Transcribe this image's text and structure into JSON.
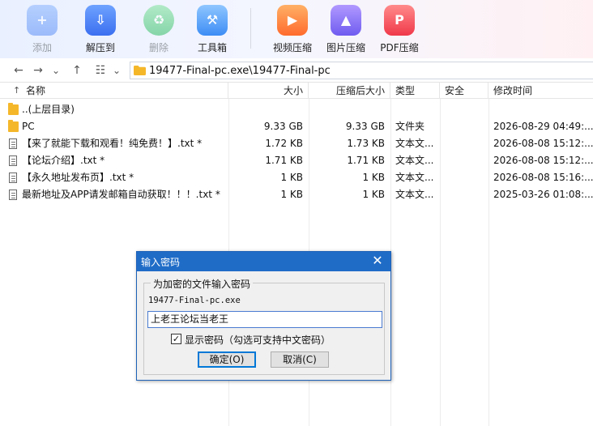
{
  "toolbar": {
    "buttons": [
      {
        "label": "添加",
        "icon": "add-archive-icon",
        "enabled": false
      },
      {
        "label": "解压到",
        "icon": "extract-icon",
        "enabled": true
      },
      {
        "label": "删除",
        "icon": "recycle-delete-icon",
        "enabled": false
      },
      {
        "label": "工具箱",
        "icon": "toolbox-icon",
        "enabled": true
      },
      {
        "label": "视频压缩",
        "icon": "video-compress-icon",
        "enabled": true
      },
      {
        "label": "图片压缩",
        "icon": "image-compress-icon",
        "enabled": true
      },
      {
        "label": "PDF压缩",
        "icon": "pdf-compress-icon",
        "enabled": true
      }
    ]
  },
  "address": {
    "back": "←",
    "forward": "→",
    "history": "⌄",
    "up": "↑",
    "view": "☷",
    "view_menu": "⌄",
    "path": "19477-Final-pc.exe\\19477-Final-pc"
  },
  "columns": {
    "sort_arrow": "↑",
    "name": "名称",
    "size": "大小",
    "packed": "压缩后大小",
    "type": "类型",
    "security": "安全",
    "modified": "修改时间"
  },
  "files": [
    {
      "name": "..(上层目录)",
      "size": "",
      "packed": "",
      "type": "",
      "security": "",
      "modified": "",
      "kind": "folder"
    },
    {
      "name": "PC",
      "size": "9.33 GB",
      "packed": "9.33 GB",
      "type": "文件夹",
      "security": "",
      "modified": "2026-08-29 04:49:...",
      "kind": "folder"
    },
    {
      "name": "【来了就能下载和观看！纯免费！】.txt *",
      "size": "1.72 KB",
      "packed": "1.73 KB",
      "type": "文本文...",
      "security": "",
      "modified": "2026-08-08 15:12:...",
      "kind": "txt"
    },
    {
      "name": "【论坛介绍】.txt *",
      "size": "1.71 KB",
      "packed": "1.71 KB",
      "type": "文本文...",
      "security": "",
      "modified": "2026-08-08 15:12:...",
      "kind": "txt"
    },
    {
      "name": "【永久地址发布页】.txt *",
      "size": "1 KB",
      "packed": "1 KB",
      "type": "文本文...",
      "security": "",
      "modified": "2026-08-08 15:16:...",
      "kind": "txt"
    },
    {
      "name": "最新地址及APP请发邮箱自动获取！！！.txt *",
      "size": "1 KB",
      "packed": "1 KB",
      "type": "文本文...",
      "security": "",
      "modified": "2025-03-26 01:08:...",
      "kind": "txt"
    }
  ],
  "dialog": {
    "title": "输入密码",
    "close": "✕",
    "group_title": "为加密的文件输入密码",
    "filename": "19477-Final-pc.exe",
    "password_value": "上老王论坛当老王",
    "checkbox_mark": "✓",
    "show_password_label": "显示密码（勾选可支持中文密码）",
    "show_password_checked": true,
    "ok_label": "确定(O)",
    "cancel_label": "取消(C)"
  }
}
